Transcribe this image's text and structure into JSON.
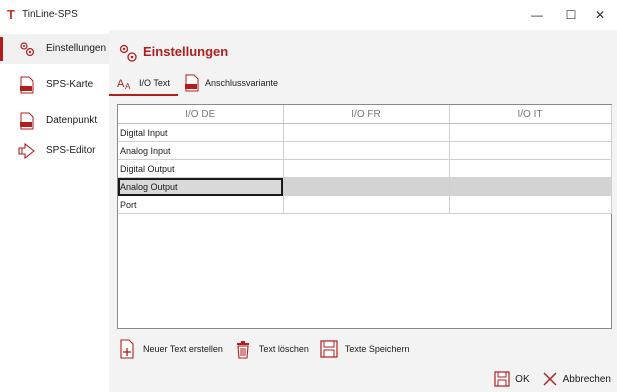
{
  "window": {
    "title": "TinLine-SPS",
    "logo_glyph": "T",
    "minimize_glyph": "—",
    "maximize_glyph": "☐",
    "close_glyph": "✕"
  },
  "sidebar": {
    "items": [
      {
        "label": "Einstellungen",
        "icon": "gears-icon",
        "active": true
      },
      {
        "label": "SPS-Karte",
        "icon": "sps-file-icon",
        "active": false
      },
      {
        "label": "Datenpunkt",
        "icon": "sps-file-icon",
        "active": false
      },
      {
        "label": "SPS-Editor",
        "icon": "editor-icon",
        "active": false
      }
    ]
  },
  "main": {
    "title": "Einstellungen",
    "tabs": [
      {
        "label": "I/O Text",
        "icon": "text-size-icon",
        "active": true
      },
      {
        "label": "Anschlussvariante",
        "icon": "sps-file-icon",
        "active": false
      }
    ],
    "table": {
      "columns": [
        "I/O DE",
        "I/O FR",
        "I/O IT"
      ],
      "rows": [
        [
          "Digital Input",
          "",
          ""
        ],
        [
          "Analog Input",
          "",
          ""
        ],
        [
          "Digital Output",
          "",
          ""
        ],
        [
          "Analog Output",
          "",
          ""
        ],
        [
          "Port",
          "",
          ""
        ]
      ],
      "selected_row": 3
    },
    "actions": {
      "new_text": "Neuer Text erstellen",
      "delete_text": "Text löschen",
      "save_texts": "Texte Speichern"
    }
  },
  "footer": {
    "ok_label": "OK",
    "cancel_label": "Abbrechen"
  },
  "colors": {
    "accent": "#b01e1e",
    "selection": "#d3d3d3"
  }
}
